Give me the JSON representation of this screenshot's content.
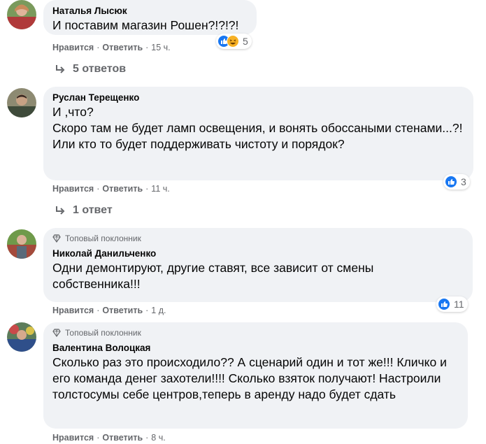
{
  "comments": [
    {
      "author": "Наталья Лысюк",
      "badge": "",
      "text": "И поставим магазин Рошен?!?!?!",
      "like": "Нравится",
      "reply": "Ответить",
      "time": "15 ч.",
      "reactions_count": "5",
      "replies": "5 ответов"
    },
    {
      "author": "Руслан Терещенко",
      "badge": "",
      "text": "И ,что?\nСкоро там не будет ламп освещения, и вонять обоссаными стенами...?!\nИли кто то будет поддерживать чистоту и порядок?",
      "like": "Нравится",
      "reply": "Ответить",
      "time": "11 ч.",
      "reactions_count": "3",
      "replies": "1 ответ"
    },
    {
      "author": "Николай Данильченко",
      "badge": "Топовый поклонник",
      "text": "Одни демонтируют, другие ставят, все зависит от смены собственника!!!",
      "like": "Нравится",
      "reply": "Ответить",
      "time": "1 д.",
      "reactions_count": "11"
    },
    {
      "author": "Валентина Волоцкая",
      "badge": "Топовый поклонник",
      "text": "Сколько раз это происходило?? А сценарий один и тот же!!! Кличко и его команда денег захотели!!!! Сколько взяток получают! Настроили толстосумы себе центров,теперь в аренду надо будет сдать",
      "like": "Нравится",
      "reply": "Ответить",
      "time": "8 ч."
    }
  ],
  "colors": {
    "bubble": "#f0f2f5",
    "meta": "#65676b",
    "like_blue": "#1877f2",
    "haha_yellow": "#f7b125"
  },
  "icons": [
    "like-icon",
    "haha-icon",
    "reply-arrow-icon",
    "diamond-badge-icon"
  ]
}
